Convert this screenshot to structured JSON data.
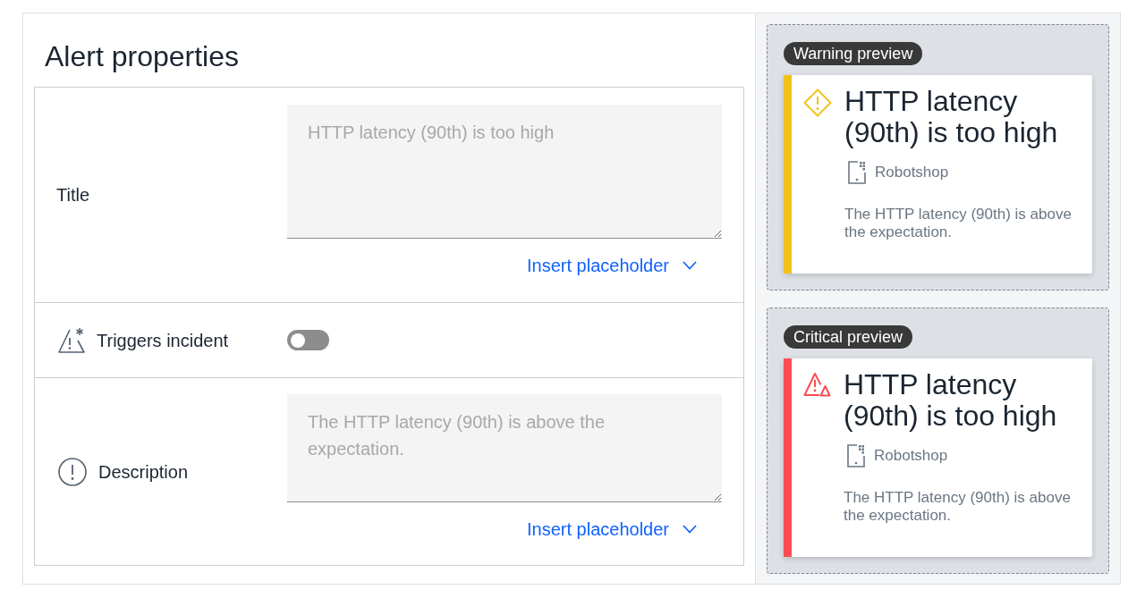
{
  "title": "Alert properties",
  "form": {
    "rows": [
      {
        "kind": "title",
        "label": "Title",
        "placeholder": "HTTP latency (90th) is too high",
        "link": "Insert placeholder"
      },
      {
        "kind": "toggle",
        "label": "Triggers incident",
        "on": false
      },
      {
        "kind": "description",
        "label": "Description",
        "placeholder": "The HTTP latency (90th) is above the expectation.",
        "link": "Insert placeholder"
      }
    ]
  },
  "previews": [
    {
      "kind": "warning",
      "badge": "Warning preview",
      "color": "#f1c21b",
      "title": "HTTP latency (90th) is too high",
      "source": "Robotshop",
      "description": "The HTTP latency (90th) is above the expectation."
    },
    {
      "kind": "critical",
      "badge": "Critical preview",
      "color": "#fa4d56",
      "title": "HTTP latency (90th) is too high",
      "source": "Robotshop",
      "description": "The HTTP latency (90th) is above the expectation."
    }
  ]
}
